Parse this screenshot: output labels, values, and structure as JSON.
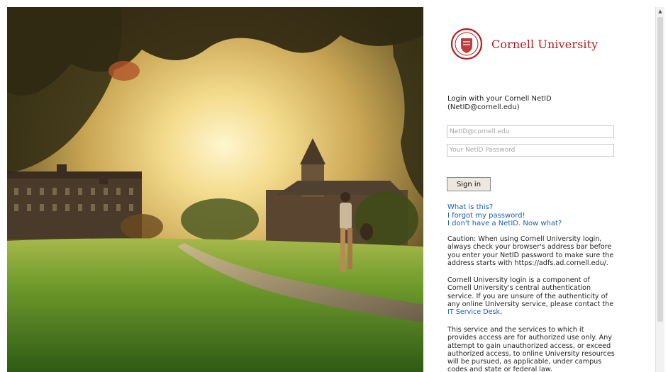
{
  "brand": {
    "name": "Cornell University",
    "color": "#b31b1b"
  },
  "login": {
    "prompt": "Login with your Cornell NetID (NetID@cornell.edu)",
    "netid_placeholder": "NetID@cornell.edu",
    "password_placeholder": "Your NetID Password",
    "signin_label": "Sign in"
  },
  "links": {
    "what_is_this": "What is this?",
    "forgot_password": "I forgot my password!",
    "no_netid": "I don't have a NetID. Now what?",
    "color": "#1a5eb8"
  },
  "notices": {
    "caution": "Caution: When using Cornell University login, always check your browser's address bar before you enter your NetID password to make sure the address starts with https://adfs.ad.cornell.edu/.",
    "component_text": "Cornell University login is a component of Cornell University's central authentication service. If you are unsure of the authenticity of any online University service, please contact the",
    "it_service_desk": "IT Service Desk",
    "period": ".",
    "authorized_use": "This service and the services to which it provides access are for authorized use only. Any attempt to gain unauthorized access, or exceed authorized access, to online University resources will be pursued, as applicable, under campus codes and state or federal law."
  },
  "icons": {
    "seal": "cornell-seal-icon",
    "scroll_up": "scroll-up-arrow-icon"
  }
}
